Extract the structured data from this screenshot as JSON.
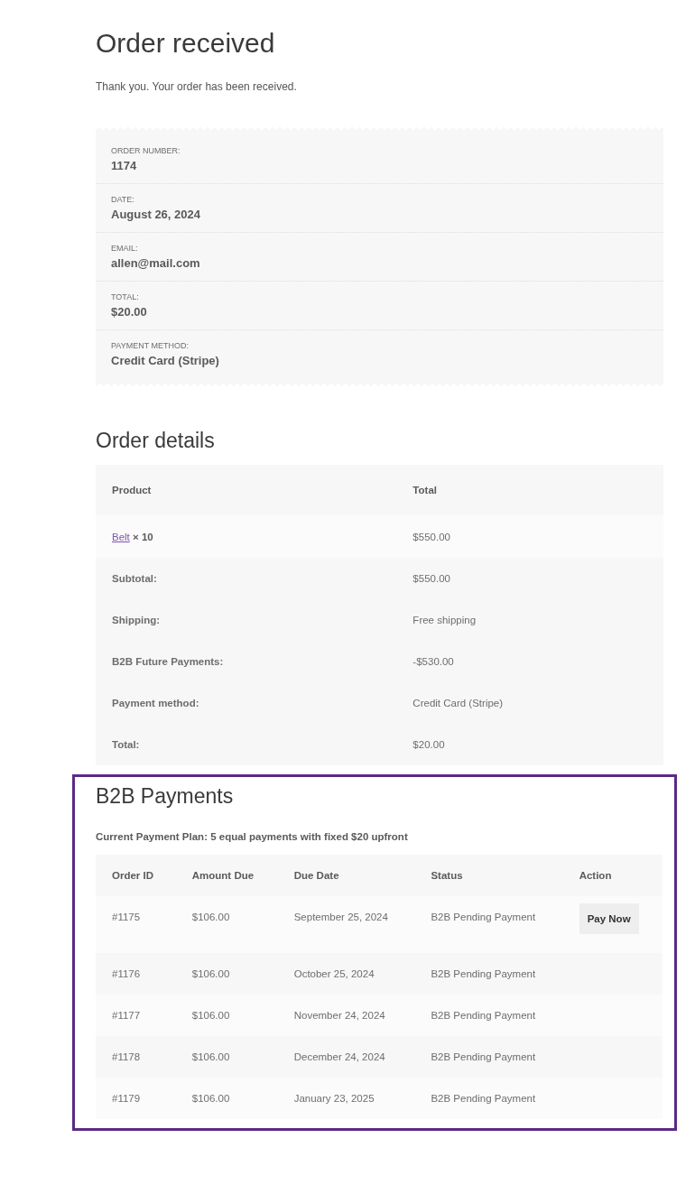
{
  "title": "Order received",
  "notice": "Thank you. Your order has been received.",
  "overview": [
    {
      "label": "ORDER NUMBER:",
      "value": "1174"
    },
    {
      "label": "DATE:",
      "value": "August 26, 2024"
    },
    {
      "label": "EMAIL:",
      "value": "allen@mail.com"
    },
    {
      "label": "TOTAL:",
      "value": "$20.00"
    },
    {
      "label": "PAYMENT METHOD:",
      "value": "Credit Card (Stripe)"
    }
  ],
  "order_details": {
    "title": "Order details",
    "columns": [
      "Product",
      "Total"
    ],
    "items": [
      {
        "name": "Belt",
        "quantity": "× 10",
        "total": "$550.00"
      }
    ],
    "totals": [
      {
        "label": "Subtotal:",
        "value": "$550.00"
      },
      {
        "label": "Shipping:",
        "value": "Free shipping"
      },
      {
        "label": "B2B Future Payments:",
        "value": "-$530.00"
      },
      {
        "label": "Payment method:",
        "value": "Credit Card (Stripe)"
      },
      {
        "label": "Total:",
        "value": "$20.00"
      }
    ]
  },
  "b2b_payments": {
    "title": "B2B Payments",
    "plan": "Current Payment Plan: 5 equal payments with fixed $20 upfront",
    "columns": [
      "Order ID",
      "Amount Due",
      "Due Date",
      "Status",
      "Action"
    ],
    "rows": [
      {
        "order_id": "#1175",
        "amount": "$106.00",
        "due_date": "September 25, 2024",
        "status": "B2B Pending Payment",
        "action": "Pay Now"
      },
      {
        "order_id": "#1176",
        "amount": "$106.00",
        "due_date": "October 25, 2024",
        "status": "B2B Pending Payment"
      },
      {
        "order_id": "#1177",
        "amount": "$106.00",
        "due_date": "November 24, 2024",
        "status": "B2B Pending Payment"
      },
      {
        "order_id": "#1178",
        "amount": "$106.00",
        "due_date": "December 24, 2024",
        "status": "B2B Pending Payment"
      },
      {
        "order_id": "#1179",
        "amount": "$106.00",
        "due_date": "January 23, 2025",
        "status": "B2B Pending Payment"
      }
    ]
  }
}
